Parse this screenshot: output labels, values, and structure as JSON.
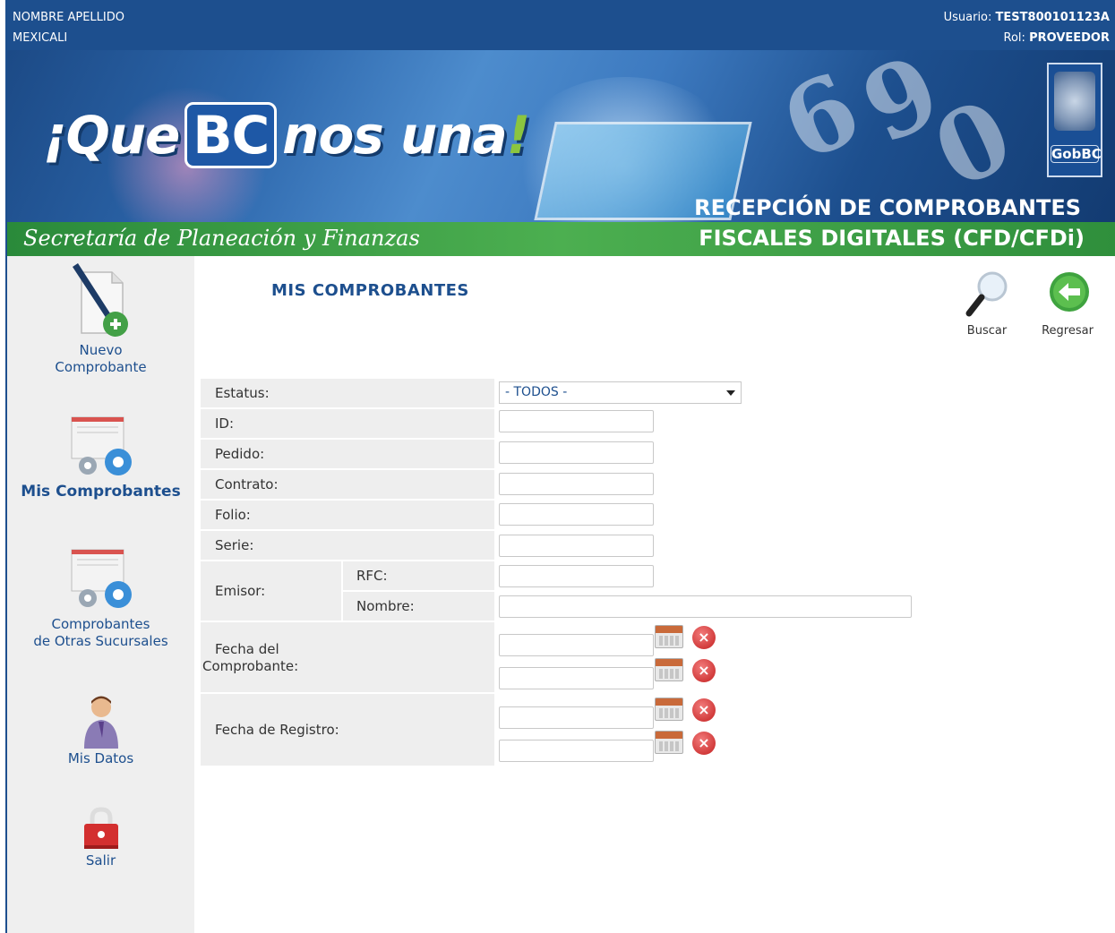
{
  "topbar": {
    "name": "NOMBRE APELLIDO",
    "city": "MEXICALI",
    "user_label": "Usuario:",
    "user_value": "TEST800101123A",
    "role_label": "Rol:",
    "role_value": "PROVEEDOR"
  },
  "banner": {
    "logo_pre": "¡Que",
    "logo_bc": "BC",
    "logo_post": "nos una",
    "logo_ex": "!",
    "secretaria": "Secretaría de Planeación y Finanzas",
    "title_line1": "RECEPCIÓN DE COMPROBANTES",
    "title_line2": "FISCALES DIGITALES (CFD/CFDi)",
    "gob_logo": "GobBC"
  },
  "sidebar": {
    "items": [
      {
        "label1": "Nuevo",
        "label2": "Comprobante",
        "icon": "new-document-icon"
      },
      {
        "label1": "Mis Comprobantes",
        "label2": "",
        "icon": "documents-gear-icon"
      },
      {
        "label1": "Comprobantes",
        "label2": "de Otras Sucursales",
        "icon": "documents-gear-icon"
      },
      {
        "label1": "Mis Datos",
        "label2": "",
        "icon": "user-icon"
      },
      {
        "label1": "Salir",
        "label2": "",
        "icon": "lock-icon"
      }
    ]
  },
  "main": {
    "title": "MIS COMPROBANTES",
    "toolbar": {
      "search_label": "Buscar",
      "back_label": "Regresar"
    },
    "form": {
      "estatus_label": "Estatus:",
      "estatus_value": "- TODOS -",
      "id_label": "ID:",
      "pedido_label": "Pedido:",
      "contrato_label": "Contrato:",
      "folio_label": "Folio:",
      "serie_label": "Serie:",
      "emisor_label": "Emisor:",
      "rfc_label": "RFC:",
      "nombre_label": "Nombre:",
      "fecha_comp_label1": "Fecha del",
      "fecha_comp_label2": "Comprobante:",
      "fecha_reg_label": "Fecha de Registro:"
    }
  },
  "colors": {
    "primary": "#1d4f8e",
    "green": "#4caf50",
    "sidebar_bg": "#efefef",
    "label_bg": "#eeeeee"
  }
}
